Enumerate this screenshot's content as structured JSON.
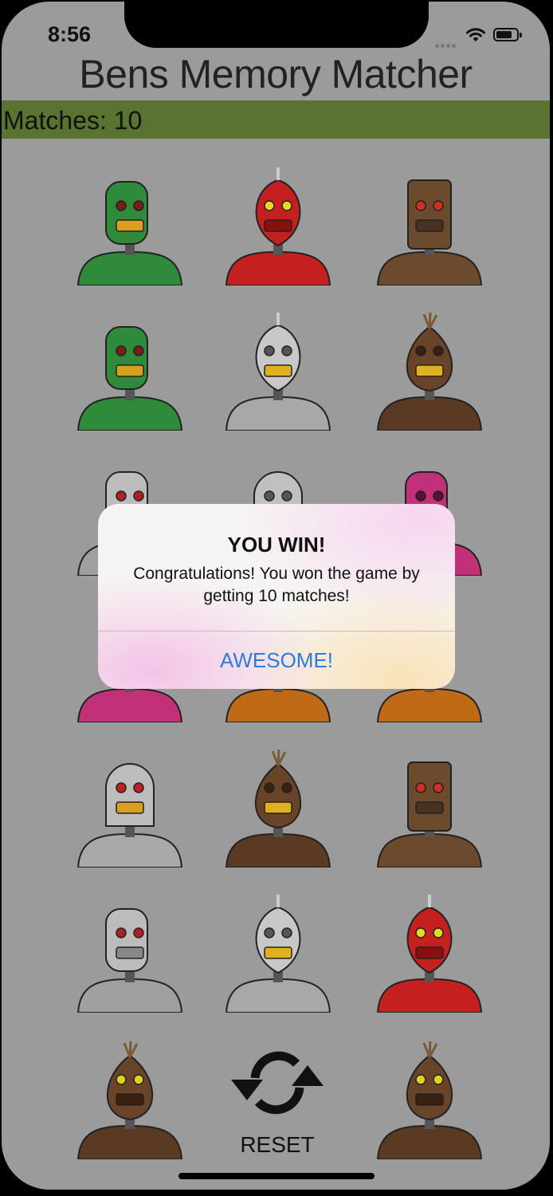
{
  "status_bar": {
    "time": "8:56",
    "battery_level": 0.8
  },
  "app": {
    "title": "Bens Memory Matcher",
    "matches_label": "Matches: 10"
  },
  "colors": {
    "background": "#9b9b9b",
    "match_bar": "#5b7331",
    "alert_button": "#2d7be0"
  },
  "grid": {
    "rows": [
      [
        "green-robot",
        "red-robot",
        "brown-block-robot"
      ],
      [
        "green-robot",
        "silver-spike-robot",
        "brown-onion-robot"
      ],
      [
        "gray-cyclops-robot",
        "silver-dome-robot",
        "pink-robot"
      ],
      [
        "pink-robot",
        "orange-robot",
        "orange-robot"
      ],
      [
        "gray-visor-robot",
        "brown-onion-robot",
        "brown-block-robot"
      ],
      [
        "gray-cyclops-robot",
        "silver-spike-robot",
        "red-robot"
      ],
      [
        "brown-sprout-robot",
        null,
        "brown-sprout-robot"
      ]
    ]
  },
  "reset": {
    "label": "RESET",
    "icon": "refresh-icon"
  },
  "alert": {
    "title": "YOU WIN!",
    "message": "Congratulations! You won the game by getting 10 matches!",
    "button": "AWESOME!"
  }
}
